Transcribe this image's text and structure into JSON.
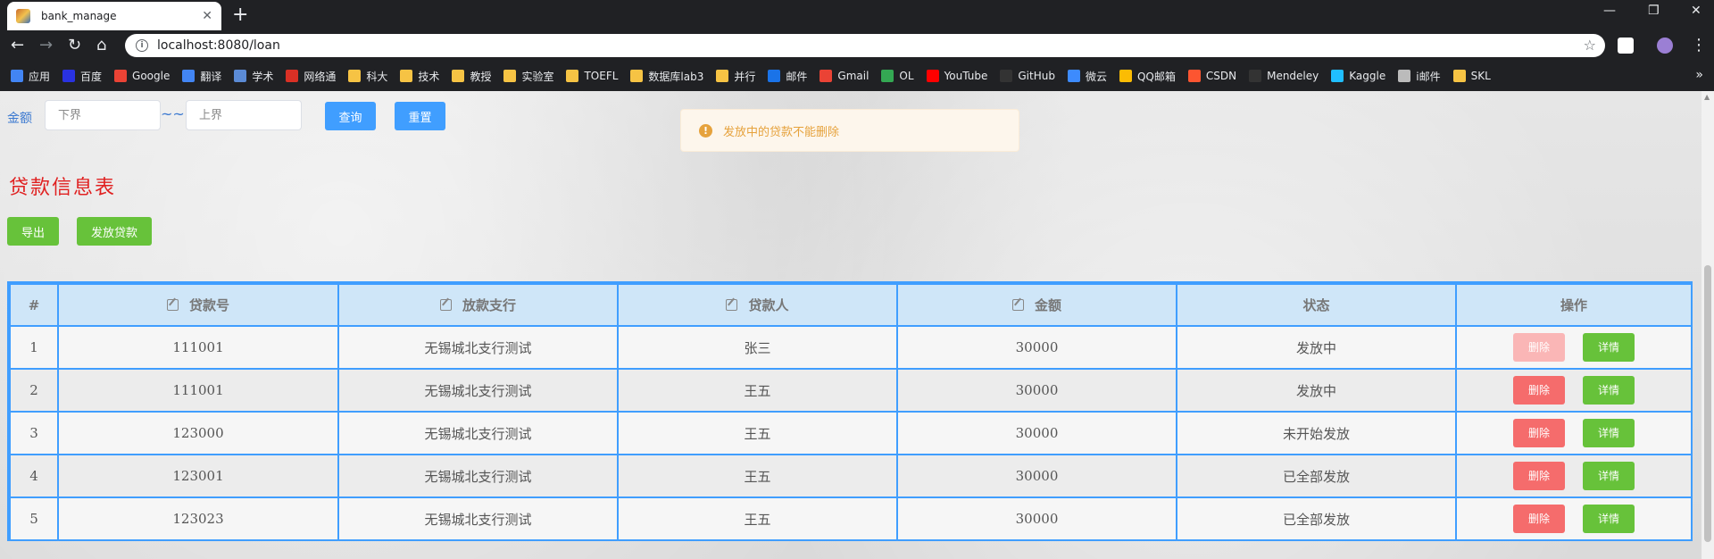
{
  "browser": {
    "tab_title": "bank_manage",
    "url": "localhost:8080/loan",
    "bookmarks": [
      {
        "label": "应用",
        "color": "#4285f4"
      },
      {
        "label": "百度",
        "color": "#2932e1"
      },
      {
        "label": "Google",
        "color": "#ea4335"
      },
      {
        "label": "翻译",
        "color": "#4285f4"
      },
      {
        "label": "学术",
        "color": "#5b8bd6"
      },
      {
        "label": "网络通",
        "color": "#d93025"
      },
      {
        "label": "科大",
        "color": "#f6c344"
      },
      {
        "label": "技术",
        "color": "#f6c344"
      },
      {
        "label": "教授",
        "color": "#f6c344"
      },
      {
        "label": "实验室",
        "color": "#f6c344"
      },
      {
        "label": "TOEFL",
        "color": "#f6c344"
      },
      {
        "label": "数据库lab3",
        "color": "#f6c344"
      },
      {
        "label": "并行",
        "color": "#f6c344"
      },
      {
        "label": "邮件",
        "color": "#1a73e8"
      },
      {
        "label": "Gmail",
        "color": "#ea4335"
      },
      {
        "label": "OL",
        "color": "#34a853"
      },
      {
        "label": "YouTube",
        "color": "#ff0000"
      },
      {
        "label": "GitHub",
        "color": "#333333"
      },
      {
        "label": "微云",
        "color": "#3d8bfd"
      },
      {
        "label": "QQ邮箱",
        "color": "#fbbc04"
      },
      {
        "label": "CSDN",
        "color": "#fc5531"
      },
      {
        "label": "Mendeley",
        "color": "#333333"
      },
      {
        "label": "Kaggle",
        "color": "#20beff"
      },
      {
        "label": "i邮件",
        "color": "#bbbbbb"
      },
      {
        "label": "SKL",
        "color": "#f6c344"
      }
    ],
    "more_label": "»"
  },
  "filter": {
    "amount_label": "金额",
    "lower_placeholder": "下界",
    "upper_placeholder": "上界",
    "tilde": "~~",
    "query_label": "查询",
    "reset_label": "重置"
  },
  "alert": {
    "icon": "!",
    "text": "发放中的贷款不能删除"
  },
  "section_title": "贷款信息表",
  "actions": {
    "export_label": "导出",
    "issue_label": "发放贷款"
  },
  "table": {
    "headers": [
      "#",
      "贷款号",
      "放款支行",
      "贷款人",
      "金额",
      "状态",
      "操作"
    ],
    "rows": [
      {
        "index": "1",
        "loan_id": "111001",
        "branch": "无锡城北支行测试",
        "borrower": "张三",
        "amount": "30000",
        "status": "发放中",
        "delete_label": "删除",
        "detail_label": "详情",
        "delete_disabled": true
      },
      {
        "index": "2",
        "loan_id": "111001",
        "branch": "无锡城北支行测试",
        "borrower": "王五",
        "amount": "30000",
        "status": "发放中",
        "delete_label": "删除",
        "detail_label": "详情",
        "delete_disabled": false
      },
      {
        "index": "3",
        "loan_id": "123000",
        "branch": "无锡城北支行测试",
        "borrower": "王五",
        "amount": "30000",
        "status": "未开始发放",
        "delete_label": "删除",
        "detail_label": "详情",
        "delete_disabled": false
      },
      {
        "index": "4",
        "loan_id": "123001",
        "branch": "无锡城北支行测试",
        "borrower": "王五",
        "amount": "30000",
        "status": "已全部发放",
        "delete_label": "删除",
        "detail_label": "详情",
        "delete_disabled": false
      },
      {
        "index": "5",
        "loan_id": "123023",
        "branch": "无锡城北支行测试",
        "borrower": "王五",
        "amount": "30000",
        "status": "已全部发放",
        "delete_label": "删除",
        "detail_label": "详情",
        "delete_disabled": false
      }
    ]
  },
  "colors": {
    "primary": "#409eff",
    "success": "#67c23a",
    "danger": "#f56c6c",
    "warning": "#e6a23c",
    "title_red": "#e02020"
  }
}
